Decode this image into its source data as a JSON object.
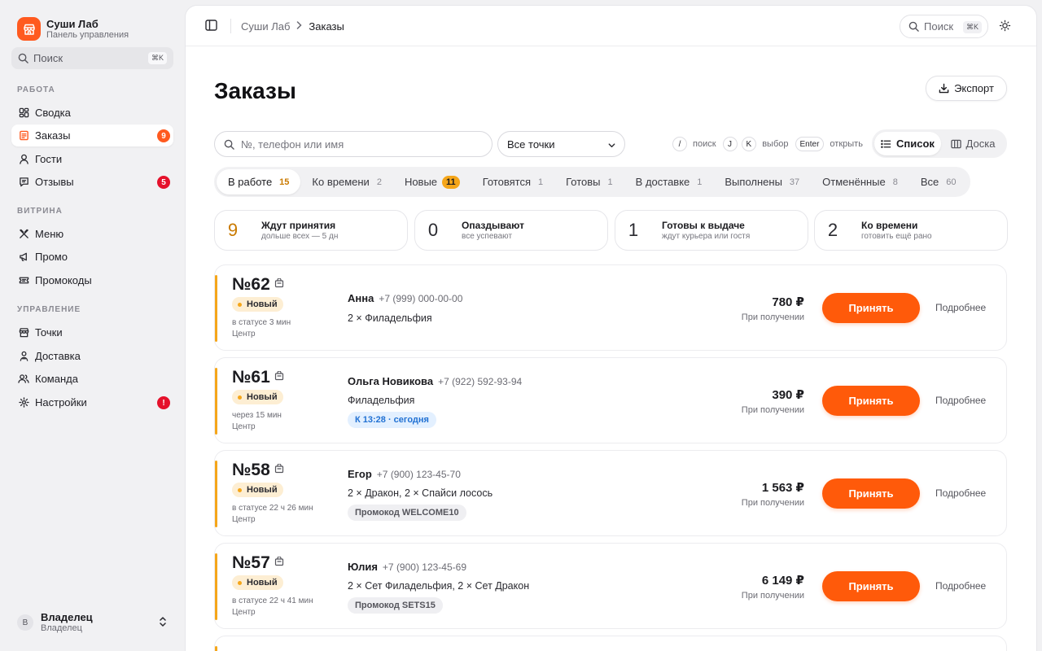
{
  "brand": {
    "name": "Суши Лаб",
    "subtitle": "Панель управления",
    "color": "#ff5a1f"
  },
  "sidebar": {
    "search": {
      "label": "Поиск",
      "shortcut": "⌘K"
    },
    "sections": [
      {
        "title": "РАБОТА"
      },
      {
        "title": "ВИТРИНА"
      },
      {
        "title": "УПРАВЛЕНИЕ"
      }
    ],
    "items": [
      {
        "label": "Сводка",
        "icon": "grid-icon"
      },
      {
        "label": "Заказы",
        "icon": "list-doc-icon",
        "badge": "9",
        "badge_color": "#ff5a1f",
        "active": true
      },
      {
        "label": "Гости",
        "icon": "person-icon"
      },
      {
        "label": "Отзывы",
        "icon": "message-icon",
        "badge": "5",
        "badge_color": "#e5112b"
      },
      {
        "label": "Меню",
        "icon": "utensils-icon"
      },
      {
        "label": "Промо",
        "icon": "megaphone-icon"
      },
      {
        "label": "Промокоды",
        "icon": "ticket-icon"
      },
      {
        "label": "Точки",
        "icon": "store-icon"
      },
      {
        "label": "Доставка",
        "icon": "courier-icon"
      },
      {
        "label": "Команда",
        "icon": "team-icon"
      },
      {
        "label": "Настройки",
        "icon": "gear-icon",
        "badge": "!",
        "badge_color": "#e5112b"
      }
    ],
    "user": {
      "avatar": "В",
      "name": "Владелец",
      "role": "Владелец"
    }
  },
  "topbar": {
    "breadcrumb": [
      "Суши Лаб",
      "Заказы"
    ],
    "search": {
      "label": "Поиск",
      "shortcut": "⌘K"
    }
  },
  "page": {
    "title": "Заказы",
    "export_label": "Экспорт",
    "search_placeholder": "№, телефон или имя",
    "location_select": "Все точки",
    "hints": [
      {
        "key": "/",
        "label": "поиск"
      },
      {
        "key": "J",
        "label": ""
      },
      {
        "key": "K",
        "label": "выбор"
      },
      {
        "key": "Enter",
        "label": "открыть"
      }
    ],
    "views": [
      {
        "label": "Список",
        "active": true
      },
      {
        "label": "Доска",
        "active": false
      }
    ]
  },
  "tabs": [
    {
      "label": "В работе",
      "count": "15",
      "active": true
    },
    {
      "label": "Ко времени",
      "count": "2"
    },
    {
      "label": "Новые",
      "count": "11",
      "pill": true
    },
    {
      "label": "Готовятся",
      "count": "1"
    },
    {
      "label": "Готовы",
      "count": "1"
    },
    {
      "label": "В доставке",
      "count": "1"
    },
    {
      "label": "Выполнены",
      "count": "37"
    },
    {
      "label": "Отменённые",
      "count": "8"
    },
    {
      "label": "Все",
      "count": "60"
    }
  ],
  "stats": [
    {
      "value": "9",
      "title": "Ждут принятия",
      "subtitle": "дольше всех — 5 дн",
      "highlight": true
    },
    {
      "value": "0",
      "title": "Опаздывают",
      "subtitle": "все успевают"
    },
    {
      "value": "1",
      "title": "Готовы к выдаче",
      "subtitle": "ждут курьера или гостя"
    },
    {
      "value": "2",
      "title": "Ко времени",
      "subtitle": "готовить ещё рано"
    }
  ],
  "orders": [
    {
      "number": "№62",
      "status": "Новый",
      "time": "в статусе 3 мин",
      "point": "Центр",
      "name": "Анна",
      "phone": "+7 (999) 000-00-00",
      "items": "2 × Филадельфия",
      "tag": "",
      "tag_type": "",
      "price": "780 ₽",
      "payment": "При получении",
      "accept": "Принять",
      "more": "Подробнее"
    },
    {
      "number": "№61",
      "status": "Новый",
      "time": "через 15 мин",
      "point": "Центр",
      "name": "Ольга Новикова",
      "phone": "+7 (922) 592-93-94",
      "items": "Филадельфия",
      "tag": "К 13:28 · сегодня",
      "tag_type": "time",
      "price": "390 ₽",
      "payment": "При получении",
      "accept": "Принять",
      "more": "Подробнее"
    },
    {
      "number": "№58",
      "status": "Новый",
      "time": "в статусе 22 ч 26 мин",
      "point": "Центр",
      "name": "Егор",
      "phone": "+7 (900) 123-45-70",
      "items": "2 × Дракон, 2 × Спайси лосось",
      "tag": "Промокод WELCOME10",
      "tag_type": "promo",
      "price": "1 563 ₽",
      "payment": "При получении",
      "accept": "Принять",
      "more": "Подробнее"
    },
    {
      "number": "№57",
      "status": "Новый",
      "time": "в статусе 22 ч 41 мин",
      "point": "Центр",
      "name": "Юлия",
      "phone": "+7 (900) 123-45-69",
      "items": "2 × Сет Филадельфия, 2 × Сет Дракон",
      "tag": "Промокод SETS15",
      "tag_type": "promo",
      "price": "6 149 ₽",
      "payment": "При получении",
      "accept": "Принять",
      "more": "Подробнее"
    }
  ],
  "colors": {
    "accent": "#ff5a0a",
    "warning": "#f5a61a",
    "danger": "#e5112b"
  }
}
